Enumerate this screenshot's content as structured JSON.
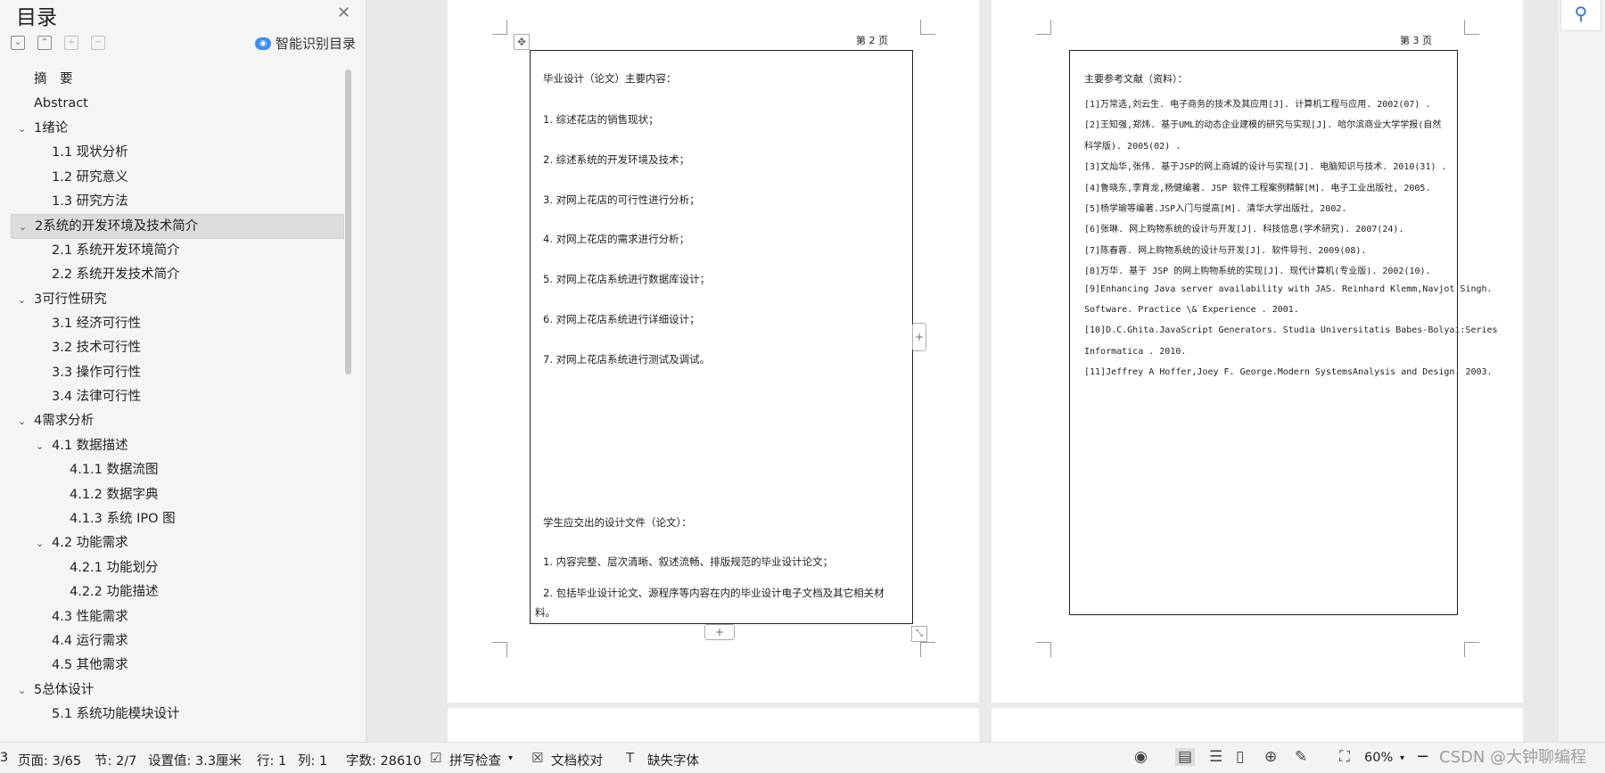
{
  "sidebar": {
    "title": "目录",
    "ai_toc_label": "智能识别目录",
    "toc": [
      {
        "label": "摘　要",
        "level": 0,
        "arrow": ""
      },
      {
        "label": "Abstract",
        "level": 0,
        "arrow": ""
      },
      {
        "label": "1绪论",
        "level": 0,
        "arrow": "v"
      },
      {
        "label": "1.1  现状分析",
        "level": 1,
        "arrow": ""
      },
      {
        "label": "1.2  研究意义",
        "level": 1,
        "arrow": ""
      },
      {
        "label": "1.3  研究方法",
        "level": 1,
        "arrow": ""
      },
      {
        "label": "2系统的开发环境及技术简介",
        "level": 0,
        "arrow": "v",
        "active": true
      },
      {
        "label": "2.1  系统开发环境简介",
        "level": 1,
        "arrow": ""
      },
      {
        "label": "2.2  系统开发技术简介",
        "level": 1,
        "arrow": ""
      },
      {
        "label": "3可行性研究",
        "level": 0,
        "arrow": "v"
      },
      {
        "label": "3.1  经济可行性",
        "level": 1,
        "arrow": ""
      },
      {
        "label": "3.2  技术可行性",
        "level": 1,
        "arrow": ""
      },
      {
        "label": "3.3  操作可行性",
        "level": 1,
        "arrow": ""
      },
      {
        "label": "3.4  法律可行性",
        "level": 1,
        "arrow": ""
      },
      {
        "label": "4需求分析",
        "level": 0,
        "arrow": "v"
      },
      {
        "label": "4.1  数据描述",
        "level": 1,
        "arrow": "v"
      },
      {
        "label": "4.1.1  数据流图",
        "level": 2,
        "arrow": ""
      },
      {
        "label": "4.1.2  数据字典",
        "level": 2,
        "arrow": ""
      },
      {
        "label": "4.1.3  系统 IPO 图",
        "level": 2,
        "arrow": ""
      },
      {
        "label": "4.2  功能需求",
        "level": 1,
        "arrow": "v"
      },
      {
        "label": "4.2.1  功能划分",
        "level": 2,
        "arrow": ""
      },
      {
        "label": "4.2.2  功能描述",
        "level": 2,
        "arrow": ""
      },
      {
        "label": "4.3  性能需求",
        "level": 1,
        "arrow": ""
      },
      {
        "label": "4.4  运行需求",
        "level": 1,
        "arrow": ""
      },
      {
        "label": "4.5  其他需求",
        "level": 1,
        "arrow": ""
      },
      {
        "label": "5总体设计",
        "level": 0,
        "arrow": "v"
      },
      {
        "label": "5.1  系统功能模块设计",
        "level": 1,
        "arrow": ""
      }
    ]
  },
  "page2": {
    "page_label": "第 2 页",
    "heading": "毕业设计（论文）主要内容：",
    "items": [
      "1. 综述花店的销售现状；",
      "2. 综述系统的开发环境及技术；",
      "3. 对网上花店的可行性进行分析；",
      "4. 对网上花店的需求进行分析；",
      "5. 对网上花店系统进行数据库设计；",
      "6. 对网上花店系统进行详细设计；",
      "7. 对网上花店系统进行测试及调试。"
    ],
    "deliverables_heading": "学生应交出的设计文件（论文）：",
    "deliverable_1": "1. 内容完整、层次清晰、叙述流畅、排版规范的毕业设计论文；",
    "deliverable_2a": "2. 包括毕业设计论文、源程序等内容在内的毕业设计电子文档及其它相关材",
    "deliverable_2b": "料。"
  },
  "page3": {
    "page_label": "第 3 页",
    "heading": "主要参考文献（资料）：",
    "refs": [
      "[1]万常选,刘云生. 电子商务的技术及其应用[J]. 计算机工程与应用. 2002(07) .",
      "[2]王知强,郑炜. 基于UML的动态企业建模的研究与实现[J]. 哈尔滨商业大学学报(自然",
      "科学版). 2005(02) .",
      "[3]文灿华,张伟. 基于JSP的网上商城的设计与实现[J]. 电脑知识与技术. 2010(31) .",
      "[4]鲁晓东,李育龙,杨健编著. JSP 软件工程案例精解[M]. 电子工业出版社, 2005.",
      "[5]杨学瑜等编著.JSP入门与提高[M]. 清华大学出版社, 2002.",
      "[6]张琳. 网上购物系统的设计与开发[J]. 科技信息(学术研究). 2007(24).",
      "[7]陈春蓉. 网上购物系统的设计与开发[J]. 软件导刊. 2009(08).",
      "[8]万华. 基于 JSP 的网上购物系统的实现[J]. 现代计算机(专业版). 2002(10).",
      "[9]Enhancing Java server availability with JAS. Reinhard Klemm,Navjot Singh.",
      "Software. Practice \\& Experience . 2001.",
      "[10]D.C.Ghita.JavaScript Generators. Studia Universitatis Babes-Bolyai:Series",
      "Informatica . 2010.",
      "[11]Jeffrey A Hoffer,Joey F. George.Modern SystemsAnalysis and Design. 2003."
    ]
  },
  "status_bar": {
    "left_cut": "3",
    "page": "页面: 3/65",
    "section": "节: 2/7",
    "setting": "设置值: 3.3厘米",
    "row": "行: 1",
    "col": "列: 1",
    "word_count": "字数: 28610",
    "spell_check": "拼写检查",
    "doc_proof": "文档校对",
    "missing_font": "缺失字体",
    "zoom": "60%"
  },
  "watermark": "CSDN @大钟聊编程",
  "icons": [
    "close-icon",
    "collapse-all-icon",
    "expand-all-icon",
    "add-heading-icon",
    "remove-heading-icon",
    "ai-icon",
    "move-handle-icon",
    "location-pin-icon",
    "eye-icon",
    "page-view-icon",
    "outline-view-icon",
    "read-view-icon",
    "web-view-icon",
    "write-view-icon",
    "fit-page-icon"
  ],
  "colors": {
    "accent": "#2a6fd8",
    "active_item_bg": "#dcdcdc",
    "canvas_bg": "#e9e9e9"
  }
}
